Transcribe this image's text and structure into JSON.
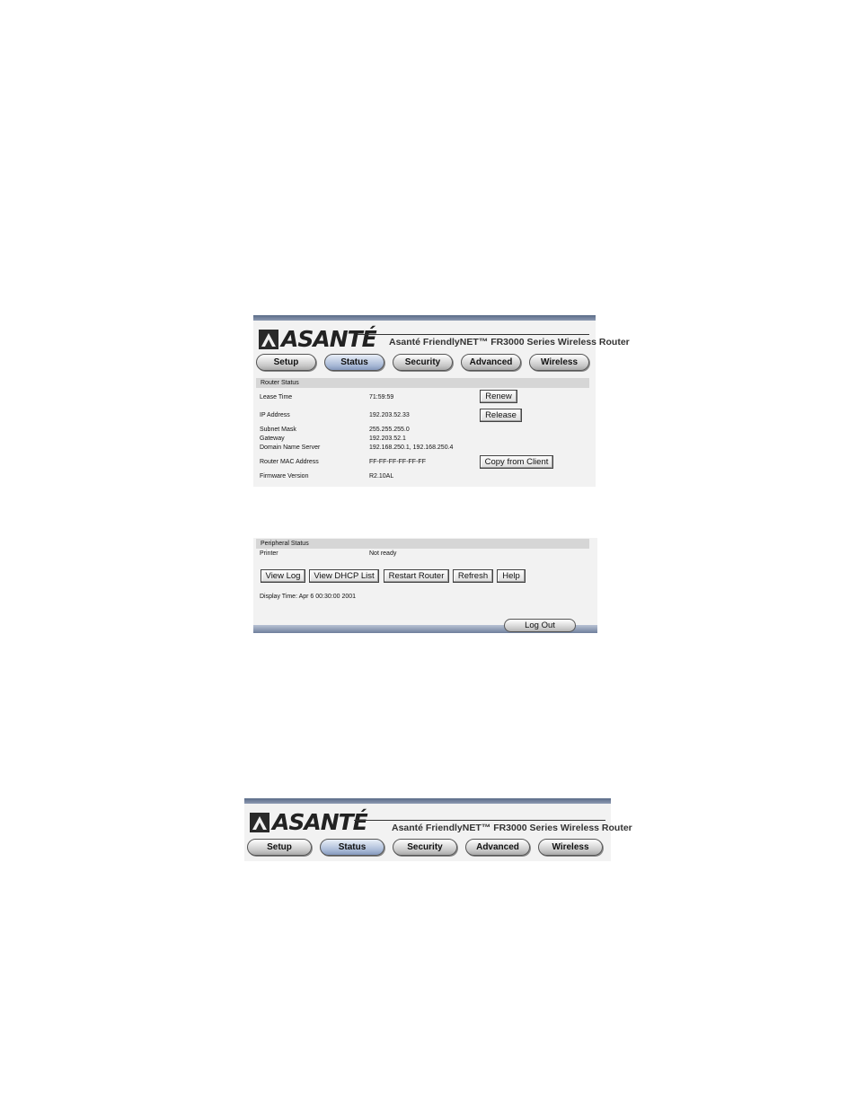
{
  "header": {
    "logo_text": "ASANTÉ",
    "product_title": "Asanté FriendlyNET™ FR3000 Series Wireless Router"
  },
  "nav": {
    "tabs": [
      {
        "label": "Setup",
        "active": false
      },
      {
        "label": "Status",
        "active": true
      },
      {
        "label": "Security",
        "active": false
      },
      {
        "label": "Advanced",
        "active": false
      },
      {
        "label": "Wireless",
        "active": false
      }
    ]
  },
  "router_status": {
    "title": "Router Status",
    "rows": [
      {
        "label": "Lease Time",
        "value": "71:59:59"
      },
      {
        "label": "IP Address",
        "value": "192.203.52.33"
      },
      {
        "label": "Subnet Mask",
        "value": "255.255.255.0"
      },
      {
        "label": "Gateway",
        "value": "192.203.52.1"
      },
      {
        "label": "Domain Name Server",
        "value": "192.168.250.1, 192.168.250.4"
      },
      {
        "label": "Router MAC Address",
        "value": "FF-FF-FF-FF-FF-FF"
      },
      {
        "label": "Firmware Version",
        "value": "R2.10AL"
      }
    ],
    "buttons": {
      "renew": "Renew",
      "release": "Release",
      "copy_from_client": "Copy from Client"
    }
  },
  "peripheral_status": {
    "title": "Peripheral Status",
    "printer_label": "Printer",
    "printer_value": "Not ready",
    "buttons": [
      "View Log",
      "View DHCP List",
      "Restart Router",
      "Refresh",
      "Help"
    ],
    "display_time": "Display Time: Apr 6 00:30:00 2001",
    "logout_label": "Log Out"
  },
  "colors": {
    "panel_bg": "#f2f2f2",
    "section_header_bg": "#d6d6d6",
    "active_tab": "#a8b9d6",
    "top_bar": "#5a6b88"
  }
}
